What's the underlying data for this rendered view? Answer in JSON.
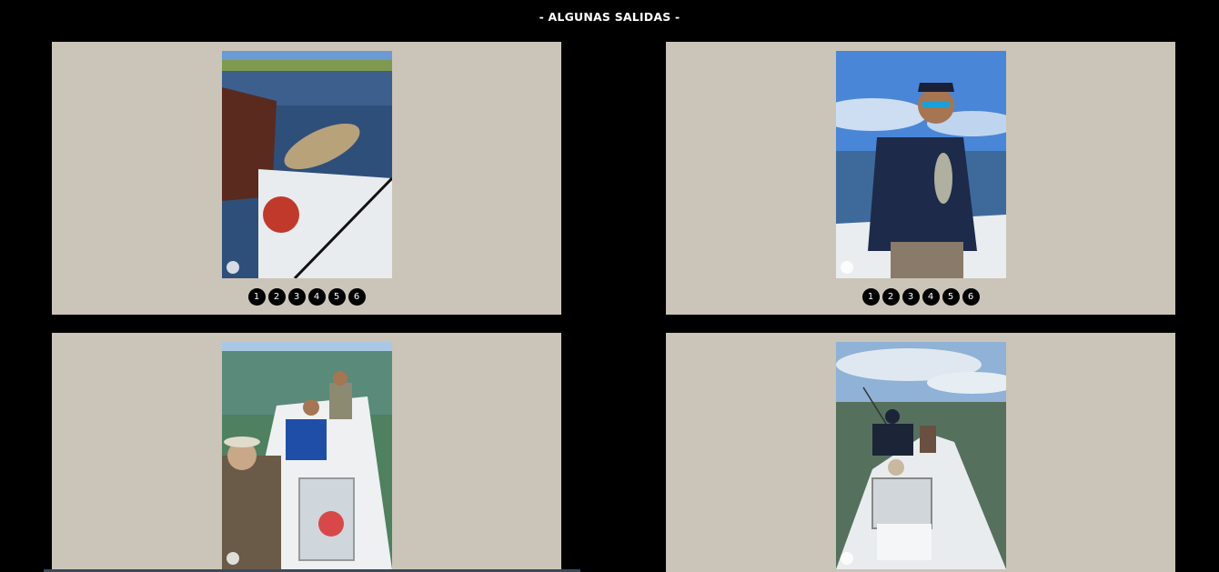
{
  "section": {
    "title": "- ALGUNAS SALIDAS -"
  },
  "cards": [
    {
      "pages": [
        "1",
        "2",
        "3",
        "4",
        "5",
        "6"
      ]
    },
    {
      "pages": [
        "1",
        "2",
        "3",
        "4",
        "5",
        "6"
      ]
    }
  ],
  "colors": {
    "background": "#000000",
    "card": "#cbc4b8",
    "dot": "#000000"
  }
}
